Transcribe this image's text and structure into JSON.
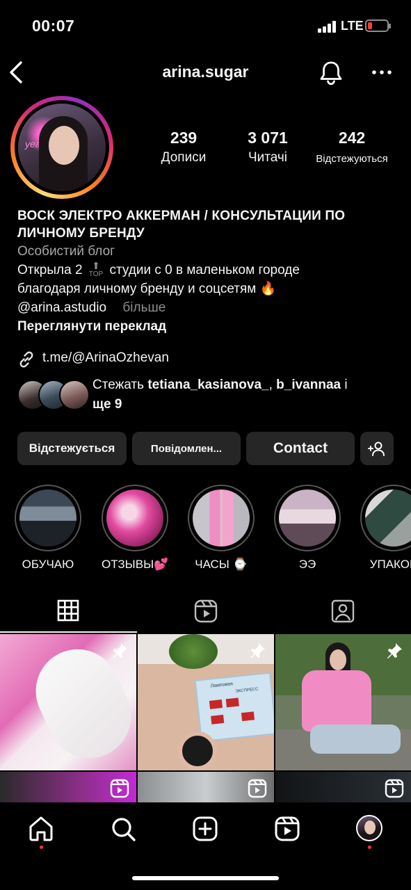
{
  "status_bar": {
    "time": "00:07",
    "network": "LTE",
    "battery_color": "#ff3b30"
  },
  "header": {
    "username": "arina.sugar",
    "back_icon": "chevron-left-icon",
    "bell_icon": "bell-icon",
    "more_icon": "more-horizontal-icon"
  },
  "profile": {
    "avatar_ring_colors": [
      "#feda75",
      "#fa7e1e",
      "#d62976",
      "#962fbf"
    ],
    "stats": [
      {
        "value": "239",
        "label": "Дописи"
      },
      {
        "value": "3 071",
        "label": "Читачі"
      },
      {
        "value": "242",
        "label": "Відстежуються"
      }
    ],
    "name_line1": "ВОСК ЭЛЕКТРО  АККЕРМАН / КОНСУЛЬТАЦИИ ПО",
    "name_line2": "ЛИЧНОМУ БРЕНДУ",
    "category": "Особистий блог",
    "bio_line1_a": "Открыла 2",
    "bio_top_icon_label": "TOP",
    "bio_line1_b": "студии с 0 в маленьком городе",
    "bio_line2": "благодаря личному бренду и соцсетям 🔥",
    "bio_mention": "@arina.astudio",
    "bio_more": "більше",
    "translate": "Переглянути переклад",
    "link": "t.me/@ArinaOzhevan",
    "followed_by_prefix": "Стежать ",
    "followed_by_user1": "tetiana_kasianova_",
    "followed_by_sep": ", ",
    "followed_by_user2": "b_ivannaa",
    "followed_by_mid": " і",
    "followed_by_more": "ще 9"
  },
  "buttons": {
    "following": "Відстежується",
    "message": "Повідомлен...",
    "contact": "Contact",
    "add_person_icon": "person-add-icon"
  },
  "highlights": [
    {
      "label": "ОБУЧАЮ"
    },
    {
      "label": "ОТЗЫВЫ💕"
    },
    {
      "label": "ЧАСЫ ⌚"
    },
    {
      "label": "ЭЭ"
    },
    {
      "label": "УПАКОВ"
    }
  ],
  "tabs": [
    {
      "icon": "grid-icon",
      "active": true
    },
    {
      "icon": "reels-icon",
      "active": false
    },
    {
      "icon": "tagged-icon",
      "active": false
    }
  ],
  "device_labels": {
    "brand": "Ламповая",
    "mode": "ЭКСПРЕСС"
  },
  "bottom_nav": [
    {
      "icon": "home-icon",
      "has_dot": true
    },
    {
      "icon": "search-icon",
      "has_dot": false
    },
    {
      "icon": "create-icon",
      "has_dot": false
    },
    {
      "icon": "reels-icon",
      "has_dot": false
    },
    {
      "icon": "profile-avatar",
      "has_dot": true
    }
  ]
}
